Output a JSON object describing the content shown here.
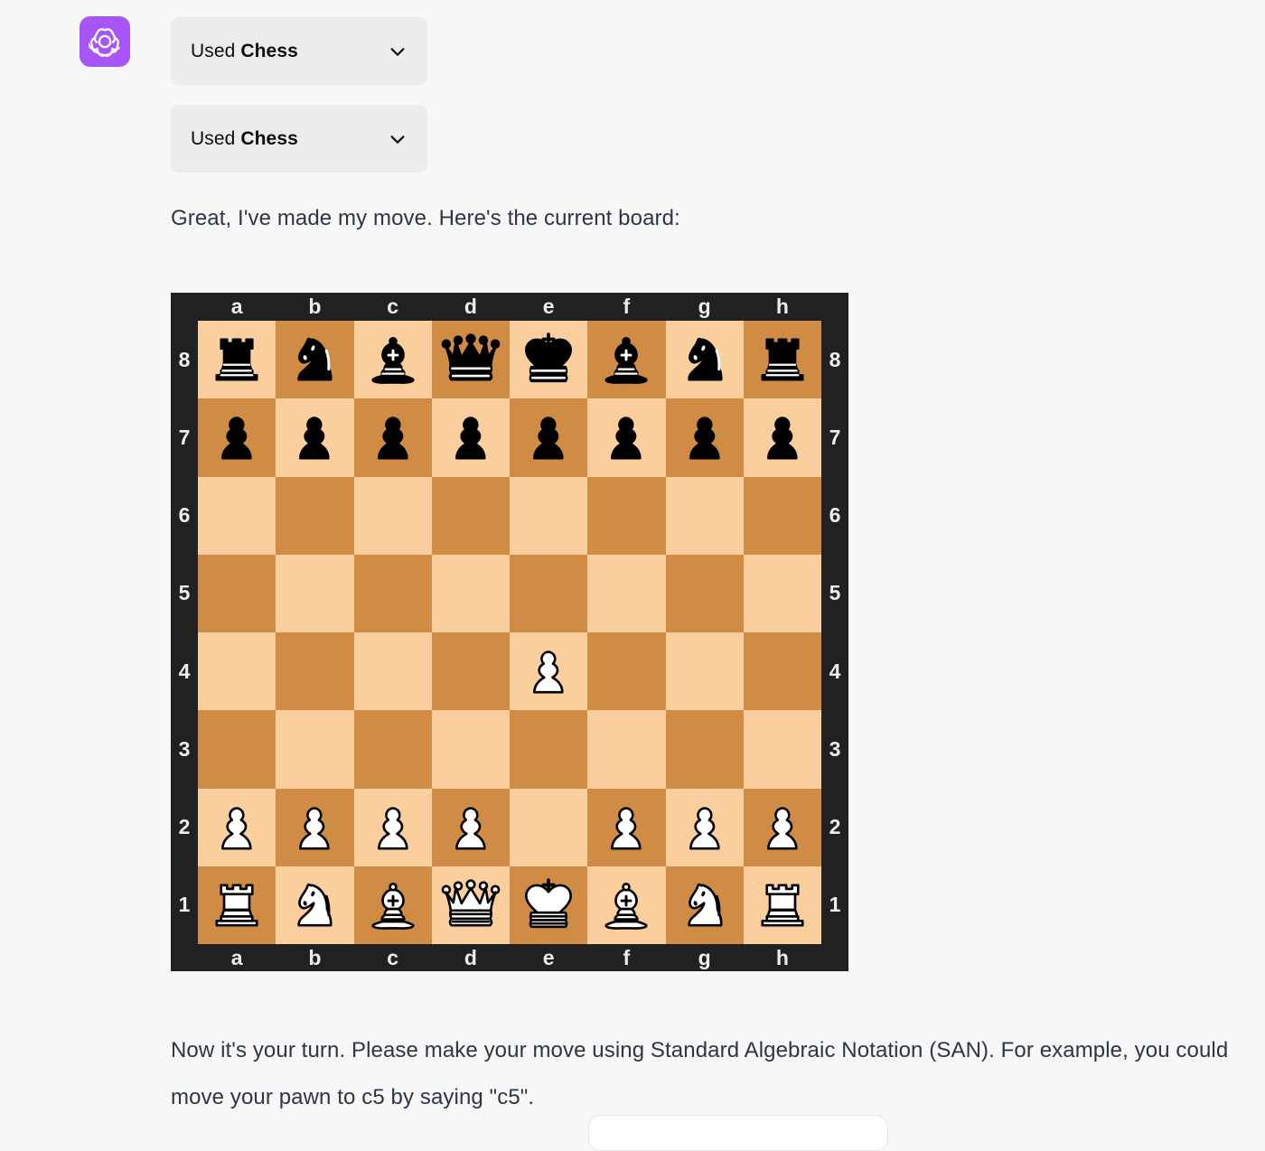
{
  "page": {
    "background_color": "#F7F7F8",
    "text_color": "#2C3645"
  },
  "avatar": {
    "icon": "openai-logo-icon",
    "background_color": "#A855F7",
    "glyph_color": "#FFFFFF"
  },
  "tool_calls": [
    {
      "lead": "Used ",
      "tool": "Chess",
      "chevron": "chevron-down-icon",
      "expanded": false
    },
    {
      "lead": "Used ",
      "tool": "Chess",
      "chevron": "chevron-down-icon",
      "expanded": false
    }
  ],
  "messages": {
    "intro": "Great, I've made my move. Here's the current board:",
    "outro": "Now it's your turn. Please make your move using Standard Algebraic Notation (SAN). For example, you could move your pawn to c5 by saying \"c5\"."
  },
  "board": {
    "frame_color": "#212121",
    "light_square_color": "#FBCE9D",
    "dark_square_color": "#D08B45",
    "coord_color": "#EDEDED",
    "files": [
      "a",
      "b",
      "c",
      "d",
      "e",
      "f",
      "g",
      "h"
    ],
    "ranks": [
      "8",
      "7",
      "6",
      "5",
      "4",
      "3",
      "2",
      "1"
    ],
    "orientation": "white-bottom",
    "position_fen": "rnbqkbnr/pppppppp/8/8/4P3/8/PPPP1PPP/RNBQKBNR",
    "rows": [
      [
        "br",
        "bn",
        "bb",
        "bq",
        "bk",
        "bb",
        "bn",
        "br"
      ],
      [
        "bp",
        "bp",
        "bp",
        "bp",
        "bp",
        "bp",
        "bp",
        "bp"
      ],
      [
        "",
        "",
        "",
        "",
        "",
        "",
        "",
        ""
      ],
      [
        "",
        "",
        "",
        "",
        "",
        "",
        "",
        ""
      ],
      [
        "",
        "",
        "",
        "",
        "wp",
        "",
        "",
        ""
      ],
      [
        "",
        "",
        "",
        "",
        "",
        "",
        "",
        ""
      ],
      [
        "wp",
        "wp",
        "wp",
        "wp",
        "",
        "wp",
        "wp",
        "wp"
      ],
      [
        "wr",
        "wn",
        "wb",
        "wq",
        "wk",
        "wb",
        "wn",
        "wr"
      ]
    ]
  },
  "composer": {
    "placeholder": ""
  }
}
